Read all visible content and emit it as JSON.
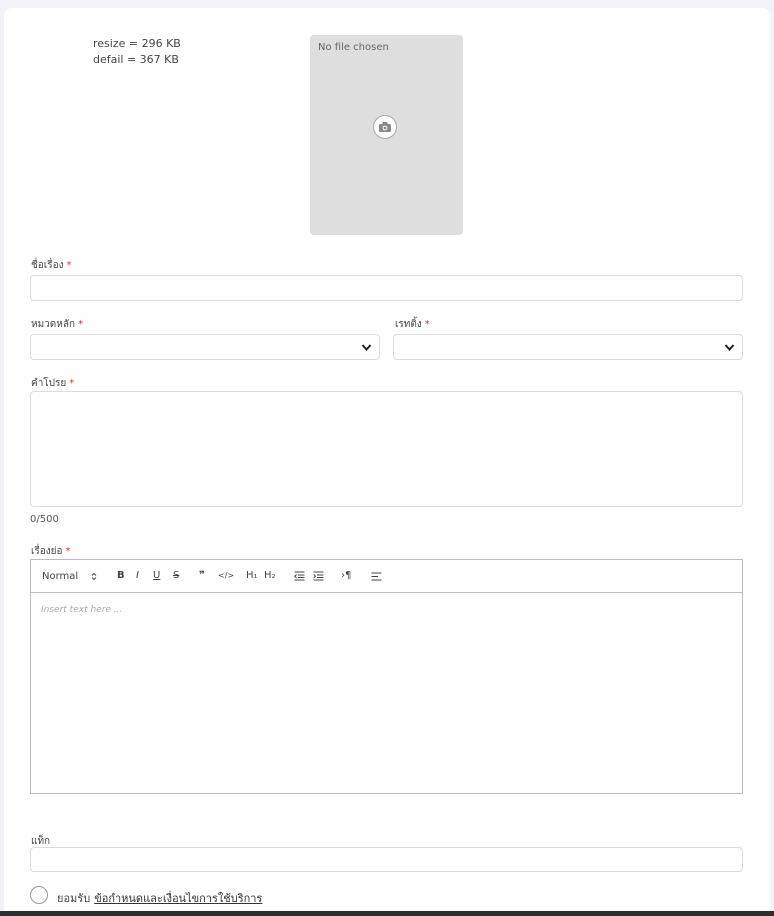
{
  "image_info": {
    "resize": "resize = 296 KB",
    "default": "defail = 367 KB"
  },
  "upload": {
    "file_status": "No file chosen",
    "icon": "camera-icon"
  },
  "form": {
    "title": {
      "label": "ชื่อเรื่อง",
      "required": "*",
      "value": ""
    },
    "main_category": {
      "label": "หมวดหลัก",
      "required": "*",
      "value": ""
    },
    "rating": {
      "label": "เรทติ้ง",
      "required": "*",
      "value": ""
    },
    "description": {
      "label": "คำโปรย",
      "required": "*",
      "value": "",
      "counter": "0/500"
    },
    "synopsis": {
      "label": "เรื่องย่อ",
      "required": "*",
      "placeholder": "Insert text here ...",
      "toolbar": {
        "heading_select": "Normal",
        "bold": "B",
        "italic": "I",
        "underline": "U",
        "strike": "S",
        "quote": "❞",
        "code": "</>",
        "h1": "H₁",
        "h2": "H₂",
        "direction": "›¶"
      }
    },
    "tags": {
      "label": "แท็ก",
      "value": ""
    },
    "terms": {
      "accept_label": "ยอมรับ",
      "link_text": "ข้อกำหนดและเงื่อนไขการใช้บริการ"
    }
  },
  "colors": {
    "required": "#e0302c",
    "upload_bg": "#dedede",
    "border": "#dcdcdc"
  }
}
